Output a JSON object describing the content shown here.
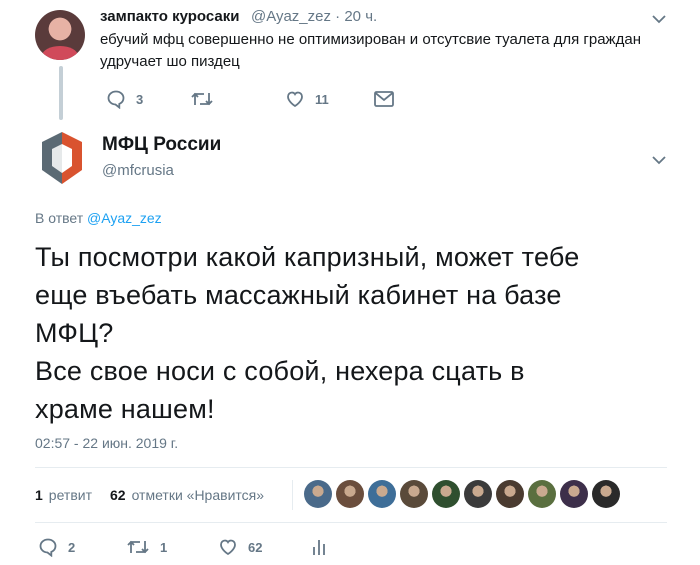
{
  "tweet1": {
    "author_name": "зампакто куросаки",
    "author_handle": "@Ayaz_zez",
    "time": "20 ч.",
    "text": "ебучий мфц совершенно не оптимизирован и отсутсвие туалета для граждан удручает шо пиздец",
    "reply_count": "3",
    "retweet_count": "",
    "like_count": "11"
  },
  "tweet2": {
    "author_name": "МФЦ России",
    "author_handle": "@mfcrusia",
    "reply_prefix": "В ответ",
    "reply_to": "@Ayaz_zez",
    "text_lines": [
      "Ты посмотри какой капризный, может тебе",
      "еще въебать массажный кабинет на базе",
      "МФЦ?",
      "Все свое носи с собой, нехера сцать в",
      "храме нашем!"
    ],
    "date": "02:57 - 22 июн. 2019 г.",
    "retweets_count": "1",
    "retweets_label": "ретвит",
    "likes_count": "62",
    "likes_label": "отметки «Нравится»",
    "reply_count": "2",
    "retweet_count": "1",
    "like_count": "62"
  },
  "colors": {
    "text": "#14171a",
    "secondary": "#657786",
    "link": "#1da1f2",
    "divider": "#e6ecf0",
    "logo_red": "#d9532f",
    "logo_gray": "#5b6a74"
  },
  "icons": {
    "reply": "speech-bubble-icon",
    "retweet": "retweet-arrows-icon",
    "like": "heart-icon",
    "dm": "envelope-icon",
    "analytics": "bar-chart-icon",
    "menu": "chevron-down-icon"
  },
  "likers": [
    "#4a6a8a",
    "#6b4e3d",
    "#3e6e98",
    "#5a4a3a",
    "#2f4f2f",
    "#3b3b3b",
    "#4a3b30",
    "#5a6f3f",
    "#3d2f4a",
    "#2a2a2a"
  ]
}
